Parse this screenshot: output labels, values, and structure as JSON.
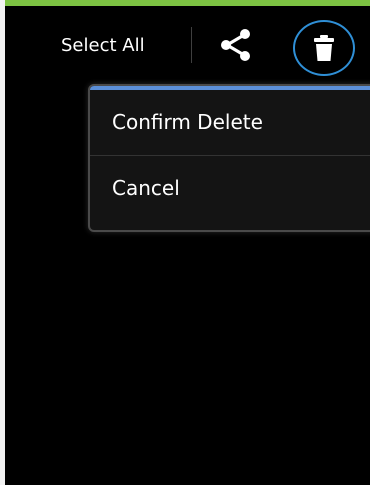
{
  "theme": {
    "accent_bar_color": "#7cc242",
    "highlight_ring_color": "#2f8fd6",
    "menu_top_line_color": "#5b8fd8"
  },
  "action_bar": {
    "select_all_label": "Select All",
    "share_icon": "share-icon",
    "delete_icon": "trash-icon"
  },
  "popup_menu": {
    "items": [
      {
        "label": "Confirm Delete"
      },
      {
        "label": "Cancel"
      }
    ]
  }
}
